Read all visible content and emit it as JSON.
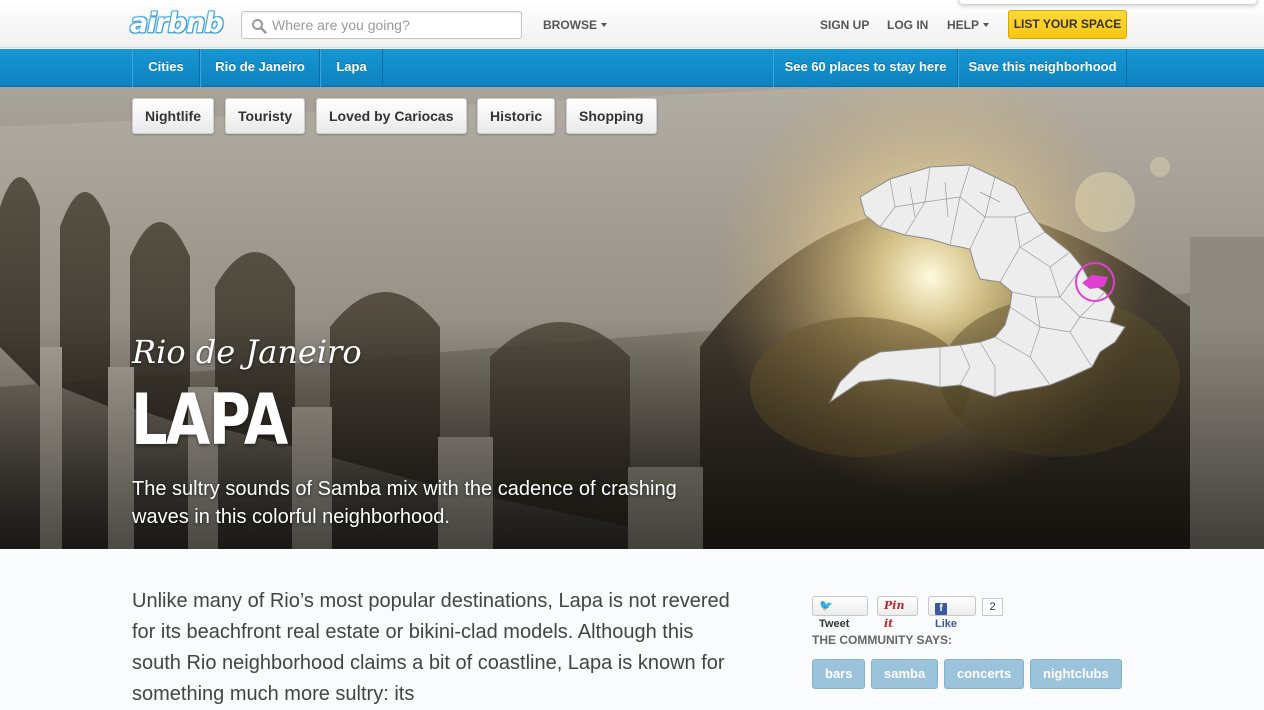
{
  "header": {
    "logo_text": "airbnb",
    "search_placeholder": "Where are you going?",
    "browse_label": "BROWSE",
    "signup_label": "SIGN UP",
    "login_label": "LOG IN",
    "help_label": "HELP",
    "list_space_label": "LIST YOUR SPACE"
  },
  "subnav": {
    "crumbs": [
      "Cities",
      "Rio de Janeiro",
      "Lapa"
    ],
    "see_places_label": "See 60 places to stay here",
    "save_label": "Save this neighborhood"
  },
  "hero": {
    "tags": [
      "Nightlife",
      "Touristy",
      "Loved by Cariocas",
      "Historic",
      "Shopping"
    ],
    "city": "Rio de Janeiro",
    "neighborhood": "LAPA",
    "tagline": "The sultry sounds of Samba mix with the cadence of crashing waves in this colorful neighborhood."
  },
  "content": {
    "intro": "Unlike many of Rio’s most popular destinations, Lapa is not revered for its beachfront real estate or bikini-clad models. Although this south Rio neighborhood claims a bit of coastline, Lapa is known for something much more sultry: its"
  },
  "sidebar": {
    "tweet_label": "Tweet",
    "pinit_label": "Pin it",
    "like_label": "Like",
    "like_count": "2",
    "community_heading": "THE COMMUNITY SAYS:",
    "community_tags": [
      "bars",
      "samba",
      "concerts",
      "nightclubs"
    ]
  },
  "colors": {
    "brand_blue": "#0e82be",
    "list_button_yellow": "#f7c515",
    "map_highlight": "#e040d0",
    "chip_blue": "#9bc4dc"
  }
}
